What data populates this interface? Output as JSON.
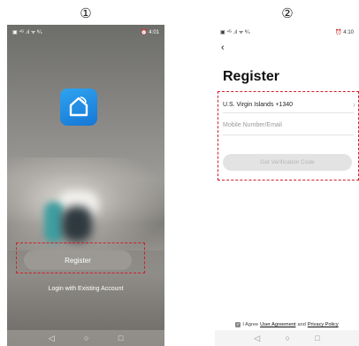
{
  "steps": {
    "first": "①",
    "second": "②"
  },
  "phone1": {
    "status": {
      "left": "▣ ⁴ᴳ .ıl ᯤ ᴷ⁄ₛ",
      "right": "⏰ 4:01"
    },
    "register_label": "Register",
    "login_label": "Login with Existing Account",
    "nav": {
      "back": "◁",
      "home": "○",
      "recent": "□"
    }
  },
  "phone2": {
    "status": {
      "left": "▣ ⁴ᴳ .ıl ᯤ ᴷ⁄ₛ",
      "right": "⏰ 4:10"
    },
    "back_icon": "‹",
    "title": "Register",
    "country_value": "U.S. Virgin Islands +1340",
    "chevron": "›",
    "phone_placeholder": "Mobile Number/Email",
    "code_button": "Get Verification Code",
    "agree": {
      "prefix": "I Agree",
      "user_agreement": "User Agreement",
      "and": "and",
      "privacy_policy": "Privacy Policy"
    },
    "nav": {
      "back": "◁",
      "home": "○",
      "recent": "□"
    }
  },
  "colors": {
    "accent_dash": "#d0202a",
    "app_icon": "#1e8ee8"
  }
}
